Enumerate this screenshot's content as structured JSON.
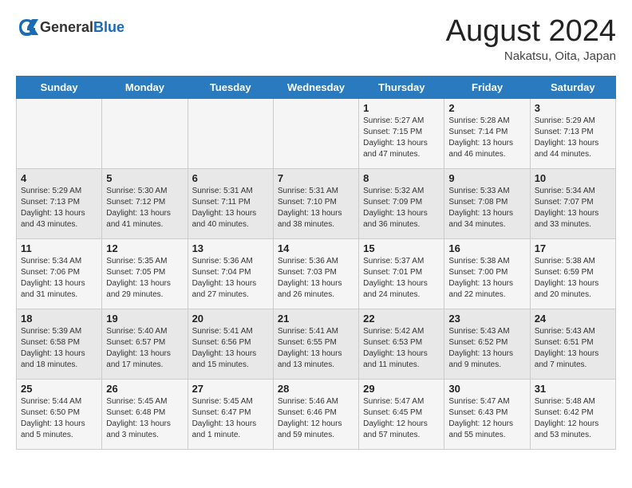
{
  "header": {
    "logo": {
      "text_general": "General",
      "text_blue": "Blue"
    },
    "title": "August 2024",
    "location": "Nakatsu, Oita, Japan"
  },
  "days_of_week": [
    "Sunday",
    "Monday",
    "Tuesday",
    "Wednesday",
    "Thursday",
    "Friday",
    "Saturday"
  ],
  "weeks": [
    {
      "days": [
        {
          "num": "",
          "info": ""
        },
        {
          "num": "",
          "info": ""
        },
        {
          "num": "",
          "info": ""
        },
        {
          "num": "",
          "info": ""
        },
        {
          "num": "1",
          "info": "Sunrise: 5:27 AM\nSunset: 7:15 PM\nDaylight: 13 hours and 47 minutes."
        },
        {
          "num": "2",
          "info": "Sunrise: 5:28 AM\nSunset: 7:14 PM\nDaylight: 13 hours and 46 minutes."
        },
        {
          "num": "3",
          "info": "Sunrise: 5:29 AM\nSunset: 7:13 PM\nDaylight: 13 hours and 44 minutes."
        }
      ]
    },
    {
      "days": [
        {
          "num": "4",
          "info": "Sunrise: 5:29 AM\nSunset: 7:13 PM\nDaylight: 13 hours and 43 minutes."
        },
        {
          "num": "5",
          "info": "Sunrise: 5:30 AM\nSunset: 7:12 PM\nDaylight: 13 hours and 41 minutes."
        },
        {
          "num": "6",
          "info": "Sunrise: 5:31 AM\nSunset: 7:11 PM\nDaylight: 13 hours and 40 minutes."
        },
        {
          "num": "7",
          "info": "Sunrise: 5:31 AM\nSunset: 7:10 PM\nDaylight: 13 hours and 38 minutes."
        },
        {
          "num": "8",
          "info": "Sunrise: 5:32 AM\nSunset: 7:09 PM\nDaylight: 13 hours and 36 minutes."
        },
        {
          "num": "9",
          "info": "Sunrise: 5:33 AM\nSunset: 7:08 PM\nDaylight: 13 hours and 34 minutes."
        },
        {
          "num": "10",
          "info": "Sunrise: 5:34 AM\nSunset: 7:07 PM\nDaylight: 13 hours and 33 minutes."
        }
      ]
    },
    {
      "days": [
        {
          "num": "11",
          "info": "Sunrise: 5:34 AM\nSunset: 7:06 PM\nDaylight: 13 hours and 31 minutes."
        },
        {
          "num": "12",
          "info": "Sunrise: 5:35 AM\nSunset: 7:05 PM\nDaylight: 13 hours and 29 minutes."
        },
        {
          "num": "13",
          "info": "Sunrise: 5:36 AM\nSunset: 7:04 PM\nDaylight: 13 hours and 27 minutes."
        },
        {
          "num": "14",
          "info": "Sunrise: 5:36 AM\nSunset: 7:03 PM\nDaylight: 13 hours and 26 minutes."
        },
        {
          "num": "15",
          "info": "Sunrise: 5:37 AM\nSunset: 7:01 PM\nDaylight: 13 hours and 24 minutes."
        },
        {
          "num": "16",
          "info": "Sunrise: 5:38 AM\nSunset: 7:00 PM\nDaylight: 13 hours and 22 minutes."
        },
        {
          "num": "17",
          "info": "Sunrise: 5:38 AM\nSunset: 6:59 PM\nDaylight: 13 hours and 20 minutes."
        }
      ]
    },
    {
      "days": [
        {
          "num": "18",
          "info": "Sunrise: 5:39 AM\nSunset: 6:58 PM\nDaylight: 13 hours and 18 minutes."
        },
        {
          "num": "19",
          "info": "Sunrise: 5:40 AM\nSunset: 6:57 PM\nDaylight: 13 hours and 17 minutes."
        },
        {
          "num": "20",
          "info": "Sunrise: 5:41 AM\nSunset: 6:56 PM\nDaylight: 13 hours and 15 minutes."
        },
        {
          "num": "21",
          "info": "Sunrise: 5:41 AM\nSunset: 6:55 PM\nDaylight: 13 hours and 13 minutes."
        },
        {
          "num": "22",
          "info": "Sunrise: 5:42 AM\nSunset: 6:53 PM\nDaylight: 13 hours and 11 minutes."
        },
        {
          "num": "23",
          "info": "Sunrise: 5:43 AM\nSunset: 6:52 PM\nDaylight: 13 hours and 9 minutes."
        },
        {
          "num": "24",
          "info": "Sunrise: 5:43 AM\nSunset: 6:51 PM\nDaylight: 13 hours and 7 minutes."
        }
      ]
    },
    {
      "days": [
        {
          "num": "25",
          "info": "Sunrise: 5:44 AM\nSunset: 6:50 PM\nDaylight: 13 hours and 5 minutes."
        },
        {
          "num": "26",
          "info": "Sunrise: 5:45 AM\nSunset: 6:48 PM\nDaylight: 13 hours and 3 minutes."
        },
        {
          "num": "27",
          "info": "Sunrise: 5:45 AM\nSunset: 6:47 PM\nDaylight: 13 hours and 1 minute."
        },
        {
          "num": "28",
          "info": "Sunrise: 5:46 AM\nSunset: 6:46 PM\nDaylight: 12 hours and 59 minutes."
        },
        {
          "num": "29",
          "info": "Sunrise: 5:47 AM\nSunset: 6:45 PM\nDaylight: 12 hours and 57 minutes."
        },
        {
          "num": "30",
          "info": "Sunrise: 5:47 AM\nSunset: 6:43 PM\nDaylight: 12 hours and 55 minutes."
        },
        {
          "num": "31",
          "info": "Sunrise: 5:48 AM\nSunset: 6:42 PM\nDaylight: 12 hours and 53 minutes."
        }
      ]
    }
  ]
}
